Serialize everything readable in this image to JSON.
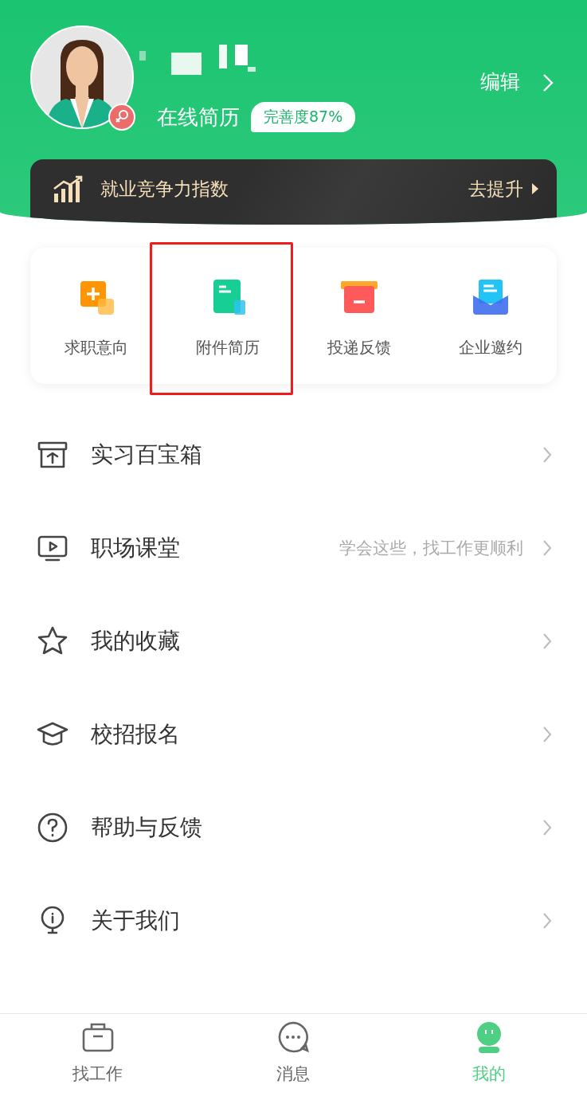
{
  "profile": {
    "resume_label": "在线简历",
    "completeness": "完善度87%",
    "edit": "编辑"
  },
  "banner": {
    "title": "就业竞争力指数",
    "action": "去提升"
  },
  "quick_actions": [
    {
      "label": "求职意向",
      "kind": "intent",
      "highlighted": false
    },
    {
      "label": "附件简历",
      "kind": "attachment",
      "highlighted": true
    },
    {
      "label": "投递反馈",
      "kind": "feedback",
      "highlighted": false
    },
    {
      "label": "企业邀约",
      "kind": "invite",
      "highlighted": false
    }
  ],
  "menu": [
    {
      "label": "实习百宝箱",
      "kind": "box"
    },
    {
      "label": "职场课堂",
      "hint": "学会这些，找工作更顺利",
      "kind": "video"
    },
    {
      "label": "我的收藏",
      "kind": "star"
    },
    {
      "label": "校招报名",
      "kind": "cap"
    },
    {
      "label": "帮助与反馈",
      "kind": "help"
    },
    {
      "label": "关于我们",
      "kind": "info"
    }
  ],
  "tabs": [
    {
      "label": "找工作",
      "kind": "jobs",
      "selected": false
    },
    {
      "label": "消息",
      "kind": "messages",
      "selected": false
    },
    {
      "label": "我的",
      "kind": "me",
      "selected": true
    }
  ]
}
